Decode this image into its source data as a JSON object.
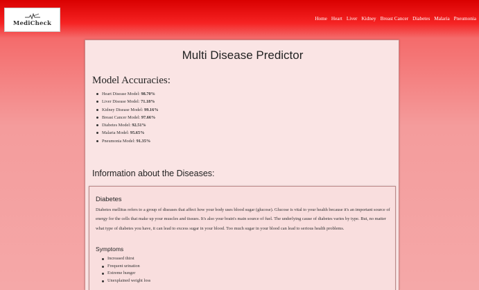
{
  "brand": {
    "name": "MediCheck"
  },
  "nav": {
    "links": [
      "Home",
      "Heart",
      "Liver",
      "Kidney",
      "Breast Cancer",
      "Diabetes",
      "Malaria",
      "Pneumonia"
    ]
  },
  "main": {
    "title": "Multi Disease Predictor",
    "accuracies_heading": "Model Accuracies:",
    "accuracies": [
      {
        "label": "Heart Disease Model:",
        "value": "98.70%"
      },
      {
        "label": "Liver Disease Model:",
        "value": "71.18%"
      },
      {
        "label": "Kidney Disease Model:",
        "value": "99.16%"
      },
      {
        "label": "Breast Cancer Model:",
        "value": "97.66%"
      },
      {
        "label": "Diabetes Model:",
        "value": "92.51%"
      },
      {
        "label": "Malaria Model:",
        "value": "95.65%"
      },
      {
        "label": "Pneumonia Model:",
        "value": "91.35%"
      }
    ],
    "info_heading": "Information about the Diseases:"
  },
  "disease": {
    "name": "Diabetes",
    "description": "Diabetes mellitus refers to a group of diseases that affect how your body uses blood sugar (glucose). Glucose is vital to your health because it's an important source of energy for the cells that make up your muscles and tissues. It's also your brain's main source of fuel. The underlying cause of diabetes varies by type. But, no matter what type of diabetes you have, it can lead to excess sugar in your blood. Too much sugar in your blood can lead to serious health problems.",
    "symptoms_heading": "Symptoms",
    "symptoms": [
      "Increased thirst",
      "Frequent urination",
      "Extreme hunger",
      "Unexplained weight loss"
    ]
  },
  "colors": {
    "navbar": "#e60000",
    "page_background": "#f5a8a8",
    "card_background": "#fae4e4"
  },
  "icons": {
    "logo": "medicheck-logo"
  }
}
